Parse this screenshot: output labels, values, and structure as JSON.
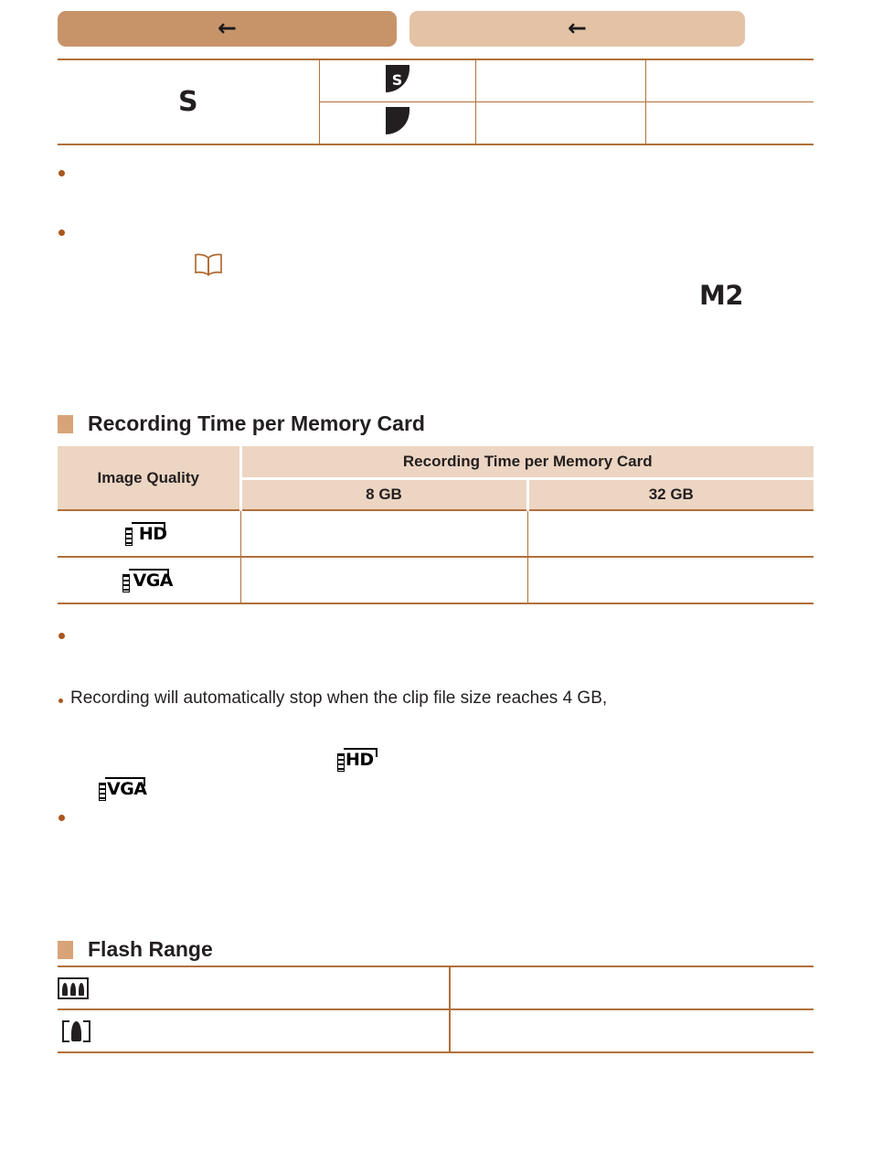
{
  "nav": {
    "back_button_label": "",
    "back_button_icon": "left-arrow-icon",
    "forward_button_label": "",
    "forward_button_icon": "left-arrow-icon",
    "primary_color": "#c7946a",
    "secondary_color": "#e3c2a6"
  },
  "quality_table": {
    "row_label": "S",
    "rows": [
      {
        "icon": "fine-compression-s-icon",
        "icon_letter": "S",
        "col2": "",
        "col3": ""
      },
      {
        "icon": "normal-compression-icon",
        "icon_letter": "",
        "col2": "",
        "col3": ""
      }
    ]
  },
  "notes_top": {
    "bullet_1": "",
    "bullet_2": "",
    "reference_icon": "open-book-icon",
    "token": "M2"
  },
  "recording_section": {
    "heading": "Recording Time per Memory Card",
    "marker_color": "#d8a477",
    "table": {
      "col_header_quality": "Image Quality",
      "col_header_span": "Recording Time per Memory Card",
      "sub_headers": [
        "8 GB",
        "32 GB"
      ],
      "header_bg": "#ecd5c2",
      "rows": [
        {
          "quality_icon": "movie-quality-hd-icon",
          "quality_label": "HD",
          "gb8": "",
          "gb32": ""
        },
        {
          "quality_icon": "movie-quality-vga-icon",
          "quality_label": "VGA",
          "gb8": "",
          "gb32": ""
        }
      ]
    }
  },
  "notes_bottom": {
    "bullet_1": "",
    "bullet_2_text": "Recording will automatically stop when the clip file size reaches 4 GB,",
    "inline_icon_hd": "HD",
    "inline_icon_vga": "VGA",
    "bullet_3": ""
  },
  "flash_section": {
    "heading": "Flash Range",
    "marker_color": "#d8a477",
    "rows": [
      {
        "zoom_icon": "wide-angle-zoom-icon",
        "value": ""
      },
      {
        "zoom_icon": "telephoto-zoom-icon",
        "value": ""
      }
    ]
  },
  "theme": {
    "rule_color": "#b0703a",
    "bullet_color": "#a8571f",
    "text_color": "#231f20"
  }
}
